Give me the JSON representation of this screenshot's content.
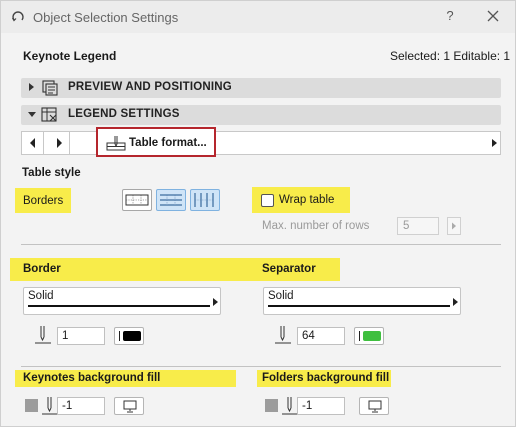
{
  "window": {
    "title": "Object Selection Settings",
    "help_label": "?",
    "header_left": "Keynote Legend",
    "header_right": "Selected: 1 Editable: 1"
  },
  "sections": [
    {
      "label": "PREVIEW AND POSITIONING",
      "expanded": false
    },
    {
      "label": "LEGEND SETTINGS",
      "expanded": true
    }
  ],
  "page_selector": {
    "label": "Table format..."
  },
  "table_style": {
    "heading": "Table style",
    "borders_label": "Borders",
    "border_styles": [
      "all-borders",
      "horizontal-borders",
      "vertical-borders"
    ],
    "active_style_index": 1,
    "wrap_table_label": "Wrap table",
    "wrap_table_checked": false,
    "max_rows_label": "Max. number of rows",
    "max_rows_value": "5"
  },
  "border": {
    "heading": "Border",
    "line_type": "Solid",
    "pen_number": "1",
    "pen_color": "#000000"
  },
  "separator": {
    "heading": "Separator",
    "line_type": "Solid",
    "pen_number": "64",
    "pen_color": "#3fbf3f"
  },
  "keynotes_fill": {
    "heading": "Keynotes background fill",
    "pen_number": "-1"
  },
  "folders_fill": {
    "heading": "Folders background fill",
    "pen_number": "-1"
  },
  "colors": {
    "highlight": "#f8ec4a",
    "page_selector_border": "#b5262d"
  }
}
